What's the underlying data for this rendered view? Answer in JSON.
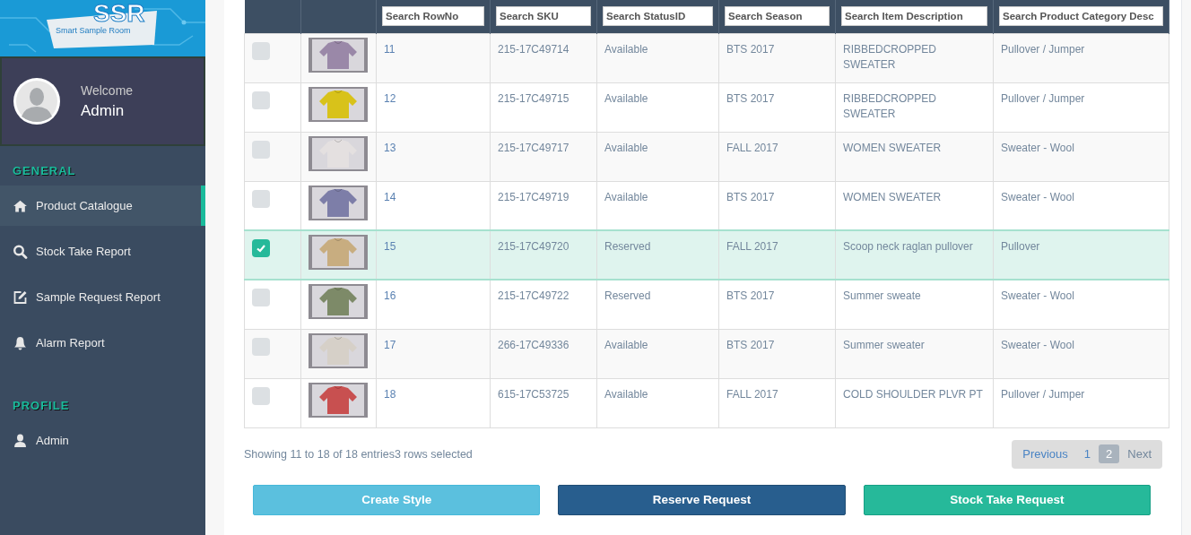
{
  "brand": {
    "logo": "SSR",
    "tagline": "Smart Sample Room"
  },
  "user": {
    "greeting": "Welcome",
    "name": "Admin"
  },
  "sidebar": {
    "sections": [
      {
        "title": "GENERAL",
        "items": [
          {
            "label": "Product Catalogue",
            "kind": "home",
            "selected": true
          },
          {
            "label": "Stock Take Report",
            "kind": "search",
            "selected": false
          },
          {
            "label": "Sample Request Report",
            "kind": "edit",
            "selected": false
          },
          {
            "label": "Alarm Report",
            "kind": "bell",
            "selected": false
          }
        ]
      },
      {
        "title": "PROFILE",
        "items": [
          {
            "label": "Admin",
            "kind": "user",
            "selected": false
          }
        ]
      }
    ]
  },
  "table": {
    "filters": [
      {
        "placeholder": "Search RowNo"
      },
      {
        "placeholder": "Search SKU"
      },
      {
        "placeholder": "Search StatusID"
      },
      {
        "placeholder": "Search Season"
      },
      {
        "placeholder": "Search Item Description"
      },
      {
        "placeholder": "Search Product Category Desc"
      }
    ],
    "rows": [
      {
        "selected": false,
        "row_no": "11",
        "sku": "215-17C49714",
        "status": "Available",
        "season": "BTS 2017",
        "description": "RIBBEDCROPPED SWEATER",
        "category": "Pullover / Jumper"
      },
      {
        "selected": false,
        "row_no": "12",
        "sku": "215-17C49715",
        "status": "Available",
        "season": "BTS 2017",
        "description": "RIBBEDCROPPED SWEATER",
        "category": "Pullover / Jumper"
      },
      {
        "selected": false,
        "row_no": "13",
        "sku": "215-17C49717",
        "status": "Available",
        "season": "FALL 2017",
        "description": "WOMEN SWEATER",
        "category": "Sweater - Wool"
      },
      {
        "selected": false,
        "row_no": "14",
        "sku": "215-17C49719",
        "status": "Available",
        "season": "BTS 2017",
        "description": "WOMEN SWEATER",
        "category": "Sweater - Wool"
      },
      {
        "selected": true,
        "row_no": "15",
        "sku": "215-17C49720",
        "status": "Reserved",
        "season": "FALL 2017",
        "description": "Scoop neck raglan pullover",
        "category": "Pullover"
      },
      {
        "selected": false,
        "row_no": "16",
        "sku": "215-17C49722",
        "status": "Reserved",
        "season": "BTS 2017",
        "description": "Summer sweate",
        "category": "Sweater - Wool"
      },
      {
        "selected": false,
        "row_no": "17",
        "sku": "266-17C49336",
        "status": "Available",
        "season": "BTS 2017",
        "description": "Summer sweater",
        "category": "Sweater - Wool"
      },
      {
        "selected": false,
        "row_no": "18",
        "sku": "615-17C53725",
        "status": "Available",
        "season": "FALL 2017",
        "description": "COLD SHOULDER PLVR PT",
        "category": "Pullover / Jumper"
      }
    ]
  },
  "info": "Showing 11 to 18 of 18 entries3 rows selected",
  "pagination": [
    {
      "label": "Previous",
      "selected": false
    },
    {
      "label": "1",
      "selected": false
    },
    {
      "label": "2",
      "selected": true
    },
    {
      "label": "Next",
      "selected": false
    }
  ],
  "actions": [
    {
      "label": "Create Style",
      "kind": "info"
    },
    {
      "label": "Reserve Request",
      "kind": "primary"
    },
    {
      "label": "Stock Take Request",
      "kind": "success"
    }
  ]
}
